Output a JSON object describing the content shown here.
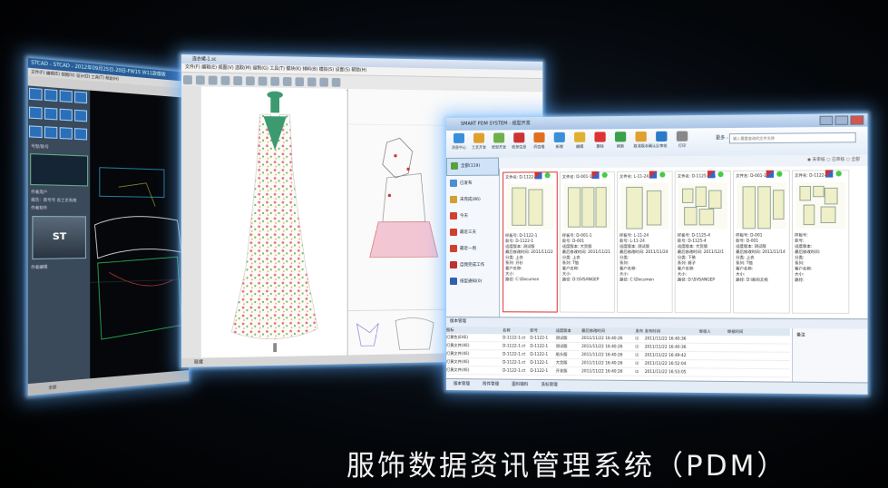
{
  "caption": "服饰数据资讯管理系统（PDM）",
  "cad_window": {
    "title": "STCAD - STCAD - 2012年09月25日-20日-FW15 W11款模板",
    "menu": "文件(F) 编辑(E) 视图(V) 设计(D) 工具(T) 帮助(H)",
    "panel_label_1": "号型/款号",
    "panel_label_2": "作者用户",
    "panel_label_3": "报告：款号号 衣工艺系统",
    "panel_label_4": "作者软件",
    "logo_text": "ST",
    "panel_label_5": "作者编辑",
    "status": "全部"
  },
  "dress_window": {
    "title": "连衣裙-1.sc",
    "menu": "文件(F)  编辑(E)  视图(V)  选取(M)  缝制(G)  工具(T)  模块(K)  排料(B)  模拟(S)  设置(S)  帮助(H)",
    "status": "就绪"
  },
  "pdm_window": {
    "title": "SMART PDM SYSTEM - 纸型开发",
    "ribbon": [
      {
        "label": "消息中心",
        "color": "#3a8fd9"
      },
      {
        "label": "工艺开发",
        "color": "#e0a030"
      },
      {
        "label": "纸型开发",
        "color": "#6fb04a"
      },
      {
        "label": "纸单信息",
        "color": "#c33"
      },
      {
        "label": "四宫格",
        "color": "#e07020"
      },
      {
        "label": "新增",
        "color": "#3a8fd9"
      },
      {
        "label": "编辑",
        "color": "#e0b030"
      },
      {
        "label": "删除",
        "color": "#d33"
      },
      {
        "label": "刷新",
        "color": "#3aa04a"
      },
      {
        "label": "取消版本确认",
        "color": "#e0a030"
      },
      {
        "label": "反审核",
        "color": "#2a7ac9"
      },
      {
        "label": "打印",
        "color": "#888"
      }
    ],
    "more_label": "更多 -",
    "search_placeholder": "输入需要查询的文件名称",
    "nav": [
      {
        "label": "全部(119)",
        "color": "#5aa03a"
      },
      {
        "label": "已发布",
        "color": "#4a8fd0"
      },
      {
        "label": "未完成(86)",
        "color": "#d0a030"
      },
      {
        "label": "今天",
        "color": "#d04030"
      },
      {
        "label": "最近三天",
        "color": "#d04030"
      },
      {
        "label": "最近一周",
        "color": "#d04030"
      },
      {
        "label": "自我完成工作",
        "color": "#c03030"
      },
      {
        "label": "纸型通知(0)",
        "color": "#3060b0"
      }
    ],
    "filter": "◉ 未审核 ○ 已审核 ○ 全部",
    "cards": [
      {
        "file": "文件名: D-1122-1.ct",
        "info": [
          "样板号: D-1122-1",
          "款号: D-1122-1",
          "适度版本: 测试版",
          "最后修改时间: 2011/11/22",
          "分类: 上衣",
          "系列: 开衫",
          "客户名称:",
          "大小:",
          "路径: C:\\Documen"
        ]
      },
      {
        "file": "文件名: D-001-1.rct",
        "info": [
          "样板号: D-001-1",
          "款号: D-001",
          "适度版本: 大货版",
          "最后修改时间: 2011/11/21",
          "分类: 上衣",
          "系列: T恤",
          "客户名称:",
          "大小:",
          "路径: D:\\SVSANGEP"
        ]
      },
      {
        "file": "文件名: L-11-24.vgf",
        "info": [
          "样板号: L-11-24",
          "款号: L-11-24",
          "适度版本: 测试版",
          "最后修改时间: 2011/11/24",
          "分类:",
          "系列:",
          "客户名称:",
          "大小:",
          "路径: C:\\Documen"
        ]
      },
      {
        "file": "文件名: D-1125-4.vs",
        "info": [
          "样板号: D-1125-4",
          "款号: D-1125-4",
          "适度版本: 大货版",
          "最后修改时间: 2011/12/1",
          "分类: 下装",
          "系列: 裤子",
          "客户名称:",
          "大小:",
          "路径: D:\\SVSANGEP"
        ]
      },
      {
        "file": "文件名: D-001-1.vgf",
        "info": [
          "样板号: D-001",
          "款号: D-001",
          "适度版本: 测试版",
          "最后修改时间: 2011/11/14",
          "分类: 上衣",
          "系列: T恤",
          "客户名称:",
          "大小:",
          "路径: D:\\新的文档"
        ]
      },
      {
        "file": "文件名: D-1122-",
        "info": [
          "样板号:",
          "款号:",
          "适度版本:",
          "最后修改时间:",
          "分类:",
          "系列:",
          "客户名称:",
          "大小:",
          "路径:"
        ]
      }
    ],
    "tabs_label": "版本管理",
    "grid_headers": [
      "图标",
      "名称",
      "款号",
      "适度版本",
      "最后修改时间",
      "发布",
      "发布时间",
      "审核人",
      "审核时间"
    ],
    "rows": [
      {
        "name": "D-1122-1.ct",
        "style": "D-1122-1",
        "ver": "测试版",
        "time": "2011/11/22 16:40:26",
        "pub": "2011/11/22 16:40:36"
      },
      {
        "name": "D-1122-1.ct",
        "style": "D-1122-1",
        "ver": "测试版",
        "time": "2011/11/22 16:40:26",
        "pub": "2011/11/22 16:40:36"
      },
      {
        "name": "D-1122-1.ct",
        "style": "D-1122-1",
        "ver": "船头版",
        "time": "2011/11/22 16:40:26",
        "pub": "2011/11/22 16:49:42"
      },
      {
        "name": "D-1122-1.ct",
        "style": "D-1122-1",
        "ver": "大货版",
        "time": "2011/11/22 16:40:26",
        "pub": "2011/11/22 16:52:04"
      },
      {
        "name": "D-1122-1.ct",
        "style": "D-1122-1",
        "ver": "开发版",
        "time": "2011/11/22 16:40:26",
        "pub": "2011/11/22 16:53:05"
      }
    ],
    "left_list": [
      "打黄色(EXE)",
      "打黄文件(XE)",
      "打黄文件(XE)",
      "打黄文件(XE)",
      "打黄文件(XE)"
    ],
    "remark_label": "备注",
    "footer": [
      "版本管理",
      "附件管理",
      "面料辅料",
      "洗标管理"
    ]
  }
}
